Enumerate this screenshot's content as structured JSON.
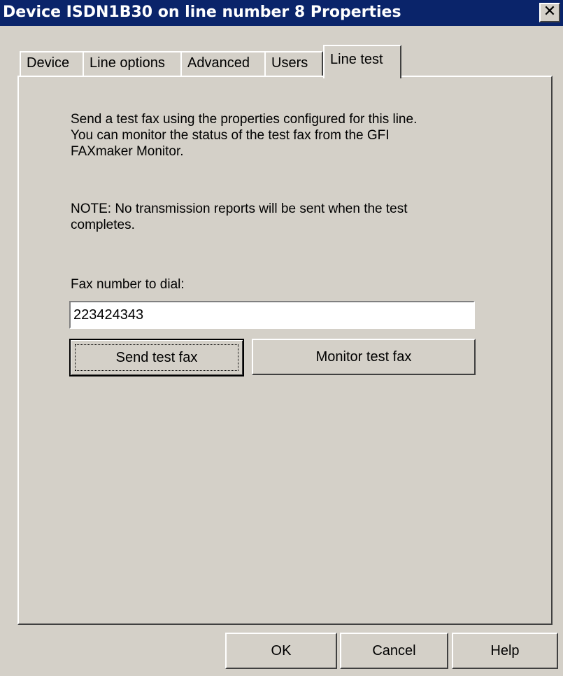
{
  "window": {
    "title": "Device ISDN1B30 on line number 8 Properties",
    "close_symbol": "✕"
  },
  "tabs": [
    {
      "label": "Device",
      "active": false
    },
    {
      "label": "Line options",
      "active": false
    },
    {
      "label": "Advanced",
      "active": false
    },
    {
      "label": "Users",
      "active": false
    },
    {
      "label": "Line test",
      "active": true
    }
  ],
  "line_test": {
    "description_lines": [
      "Send a test fax using the properties configured for this line.",
      "You can monitor the status of the test fax from the GFI",
      "FAXmaker Monitor."
    ],
    "note_lines": [
      "NOTE: No transmission reports will be sent when the test",
      "completes."
    ],
    "fax_number_label": "Fax number to dial:",
    "fax_number_value": "223424343",
    "send_button": "Send test fax",
    "monitor_button": "Monitor test fax"
  },
  "footer": {
    "ok": "OK",
    "cancel": "Cancel",
    "help": "Help"
  },
  "colors": {
    "titlebar": "#0a246a",
    "face": "#d4d0c8"
  },
  "icons": {
    "close": "close-icon"
  }
}
